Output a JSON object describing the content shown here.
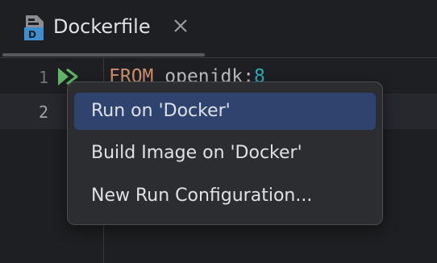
{
  "tab": {
    "title": "Dockerfile",
    "icon": "dockerfile-file-icon",
    "close_icon": "close-icon",
    "icon_color": "#3d8fd1"
  },
  "gutter": {
    "lines": [
      "1",
      "2"
    ],
    "run_icon": "run-double-arrow-icon",
    "run_icon_color": "#5fb865"
  },
  "editor": {
    "line1_keyword": "FROM",
    "line1_image": "openjdk",
    "line1_sep": ":",
    "line1_tag": "8"
  },
  "context_menu": {
    "items": [
      {
        "label": "Run on 'Docker'",
        "selected": true
      },
      {
        "label": "Build Image on 'Docker'",
        "selected": false
      },
      {
        "label": "New Run Configuration...",
        "selected": false
      }
    ],
    "selected_color": "#2e436e"
  }
}
